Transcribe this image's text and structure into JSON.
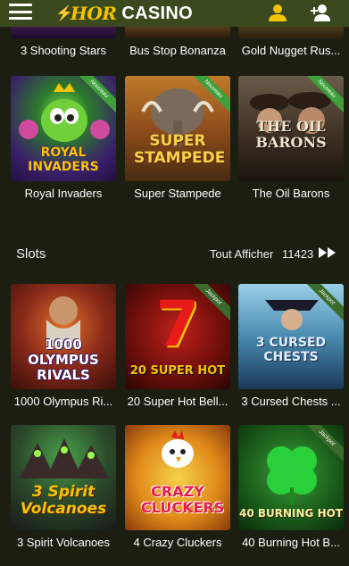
{
  "header": {
    "logo_brand": "HOR",
    "logo_suffix": "CASINO",
    "icons": [
      "menu-icon",
      "user-icon",
      "add-user-icon"
    ]
  },
  "top_row": {
    "items": [
      {
        "name": "3 Shooting Stars"
      },
      {
        "name": "Bus Stop Bonanza"
      },
      {
        "name": "Gold Nugget Rus..."
      }
    ]
  },
  "new_row": {
    "badge": "Nouveau",
    "items": [
      {
        "name": "Royal Invaders",
        "art": "ROYAL INVADERS"
      },
      {
        "name": "Super Stampede",
        "art": "SUPER STAMPEDE"
      },
      {
        "name": "The Oil Barons",
        "art": "THE OIL BARONS"
      }
    ]
  },
  "slots_section": {
    "title": "Slots",
    "show_all_label": "Tout Afficher",
    "count": "11423",
    "jackpot_badge": "Jackpot",
    "items": [
      {
        "name": "1000 Olympus Ri...",
        "art": "1000 OLYMPUS RIVALS"
      },
      {
        "name": "20 Super Hot Bell...",
        "art": "20 SUPER HOT"
      },
      {
        "name": "3 Cursed Chests ...",
        "art": "3 CURSED CHESTS"
      },
      {
        "name": "3 Spirit Volcanoes",
        "art": "3 Spirit Volcanoes"
      },
      {
        "name": "4 Crazy Cluckers",
        "art": "CRAZY CLUCKERS"
      },
      {
        "name": "40 Burning Hot B...",
        "art": "40 BURNING HOT"
      }
    ]
  },
  "colors": {
    "background": "#1b1e11",
    "header": "#3a4a1e",
    "accent": "#f5c400",
    "badge_green": "#3fa03b"
  }
}
